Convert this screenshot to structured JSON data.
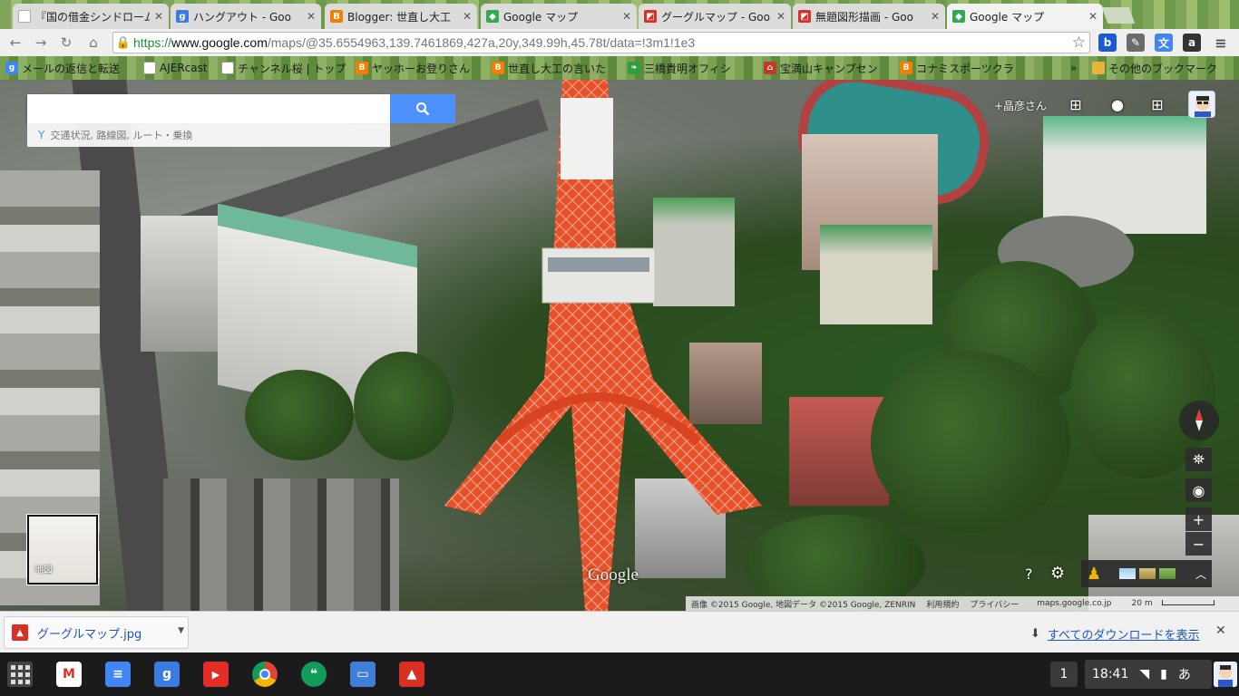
{
  "tabs": [
    {
      "title": "『国の借金シンドローム",
      "favicon": "doc-icon",
      "color": "#ffffff"
    },
    {
      "title": "ハングアウト - Goo",
      "favicon": "google-plus-icon",
      "color": "#3b7ae0"
    },
    {
      "title": "Blogger: 世直し大工",
      "favicon": "blogger-icon",
      "color": "#f57d00"
    },
    {
      "title": "Google マップ",
      "favicon": "maps-icon",
      "color": "#34a853"
    },
    {
      "title": "グーグルマップ - Goo",
      "favicon": "drawings-icon",
      "color": "#d93025"
    },
    {
      "title": "無題図形描画 - Goo",
      "favicon": "drawings-icon",
      "color": "#d93025"
    },
    {
      "title": "Google マップ",
      "favicon": "maps-icon",
      "color": "#34a853"
    }
  ],
  "toolbar": {
    "url_scheme": "https://",
    "url_host": "www.google.com",
    "url_path": "/maps/@35.6554963,139.7461869,427a,20y,349.99h,45.78t/data=!3m1!1e3"
  },
  "bookmarks": [
    {
      "label": "メールの返信と転送",
      "icon": "google-icon",
      "color": "#4285f4"
    },
    {
      "label": "AJERcast",
      "icon": "page-icon",
      "color": "#ffffff"
    },
    {
      "label": "チャンネル桜 | トップ",
      "icon": "page-icon",
      "color": "#ffffff"
    },
    {
      "label": "ヤッホーお登りさん",
      "icon": "blogger-icon",
      "color": "#f57d00"
    },
    {
      "label": "世直し大工の言いた",
      "icon": "blogger-icon",
      "color": "#f57d00"
    },
    {
      "label": "三橋貴明オフィシ",
      "icon": "leaf-icon",
      "color": "#2e9e3e"
    },
    {
      "label": "宝満山キャンプセン",
      "icon": "house-icon",
      "color": "#c0392b"
    },
    {
      "label": "コナミスポーツクラ",
      "icon": "blogger-icon",
      "color": "#f57d00"
    }
  ],
  "bookmarks_more": "»",
  "bookmarks_folder": "その他のブックマーク",
  "map": {
    "search_placeholder": "",
    "search_hint": "交通状況, 路線図, ルート・乗換",
    "user_name": "+晶彦さん",
    "minimap_label": "地図",
    "watermark": "Google",
    "footer": {
      "attribution": "画像 ©2015 Google, 地図データ ©2015 Google, ZENRIN",
      "terms": "利用規約",
      "privacy": "プライバシー",
      "domain": "maps.google.co.jp",
      "scale": "20 m"
    }
  },
  "downloads": {
    "file_name": "グーグルマップ.jpg",
    "show_all": "すべてのダウンロードを表示"
  },
  "shelf": {
    "apps": [
      {
        "name": "gmail-icon",
        "glyph": "M",
        "color": "#d93025"
      },
      {
        "name": "docs-icon",
        "glyph": "≡",
        "color": "#4285f4"
      },
      {
        "name": "google-search-icon",
        "glyph": "g",
        "color": "#3b7ae0"
      },
      {
        "name": "youtube-icon",
        "glyph": "▶",
        "color": "#e52d27"
      },
      {
        "name": "chrome-icon",
        "glyph": "",
        "color": "#e8e8e8"
      },
      {
        "name": "hangouts-icon",
        "glyph": "❝",
        "color": "#0f9d58"
      },
      {
        "name": "files-icon",
        "glyph": "▭",
        "color": "#3f7fd8"
      },
      {
        "name": "photos-icon",
        "glyph": "▲",
        "color": "#d93025"
      }
    ],
    "workspace": "1",
    "time": "18:41",
    "ime": "あ"
  }
}
